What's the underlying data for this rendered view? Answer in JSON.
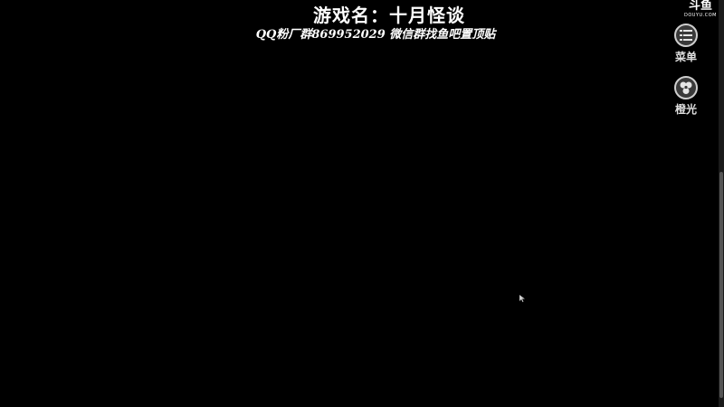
{
  "overlay": {
    "title": "游戏名：十月怪谈",
    "subtitle": "QQ粉厂群869952029 微信群找鱼吧置顶贴"
  },
  "watermark": {
    "main": "斗鱼",
    "sub": "DOUYU.COM"
  },
  "side_panel": {
    "items": [
      {
        "label": "菜单",
        "icon": "menu-icon"
      },
      {
        "label": "橙光",
        "icon": "orange-light-icon"
      }
    ]
  },
  "colors": {
    "background": "#000000",
    "text": "#ffffff",
    "button_bg": "#3a3a3a",
    "button_border": "#cfcfcf"
  }
}
